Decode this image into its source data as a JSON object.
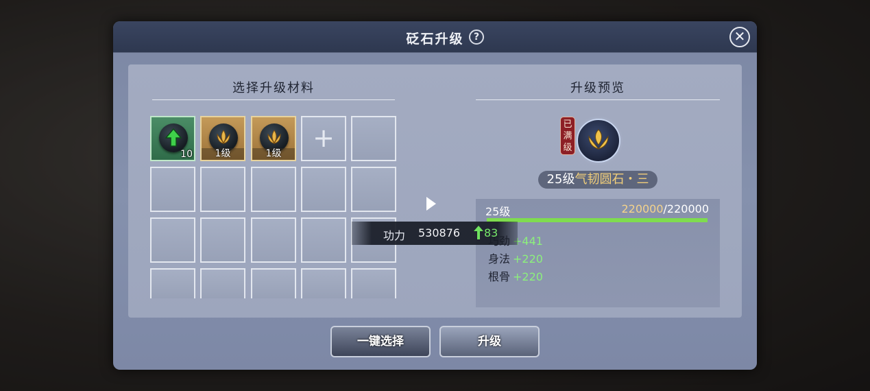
{
  "dialog": {
    "title": "砭石升级",
    "help_symbol": "?",
    "close_symbol": "✕"
  },
  "left_panel": {
    "title": "选择升级材料",
    "slots": [
      {
        "kind": "gem-green",
        "count": "10"
      },
      {
        "kind": "gem-gold",
        "level": "1级"
      },
      {
        "kind": "gem-gold",
        "level": "1级"
      },
      {
        "kind": "add",
        "symbol": "+"
      },
      {
        "kind": "empty"
      }
    ]
  },
  "right_panel": {
    "title": "升级预览",
    "max_badge": "已\n满\n级",
    "gem_level_prefix": "25级",
    "gem_name": "气韧圆石・三",
    "level_label": "25级",
    "exp_current": "220000",
    "exp_total": "/220000",
    "exp_fraction": 1.0,
    "stats": [
      {
        "name": "巧劲",
        "value": "+441"
      },
      {
        "name": "身法",
        "value": "+220"
      },
      {
        "name": "根骨",
        "value": "+220"
      }
    ]
  },
  "power": {
    "label": "功力",
    "value": "530876",
    "delta": "83"
  },
  "buttons": {
    "auto_select": "一键选择",
    "upgrade": "升级"
  },
  "colors": {
    "accent_green": "#7fdc4f",
    "gold_text": "#f2cf7a",
    "badge_red": "#8d1f25"
  }
}
